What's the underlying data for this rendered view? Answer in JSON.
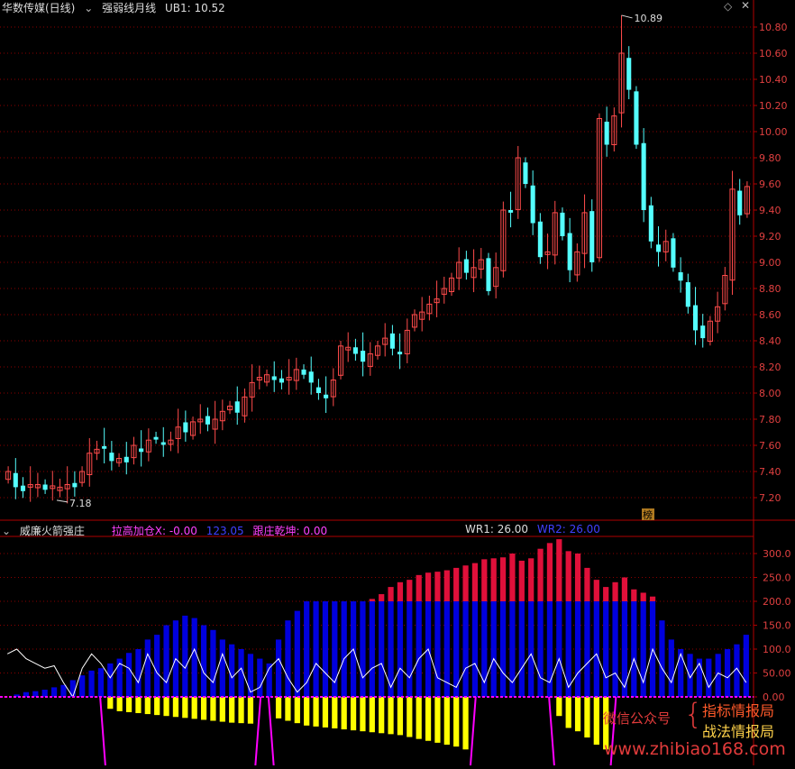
{
  "main": {
    "stock_title": "华数传媒(日线)",
    "indicator_name": "强弱线月线",
    "ub_label": "UB1: 10.52",
    "high_label": "10.89",
    "low_label": "7.18",
    "badge": "榜",
    "controls": {
      "settings_icon": "diamond-icon",
      "close_icon": "close-icon"
    },
    "ytick_labels": [
      "10.80",
      "10.60",
      "10.40",
      "10.20",
      "10.00",
      "9.80",
      "9.60",
      "9.40",
      "9.20",
      "9.00",
      "8.80",
      "8.60",
      "8.40",
      "8.20",
      "8.00",
      "7.80",
      "7.60",
      "7.40",
      "7.20"
    ]
  },
  "sub": {
    "title": "威廉火箭强庄",
    "val1": "拉高加仓X: -0.00",
    "val2": "123.05",
    "val3": "跟庄乾坤: 0.00",
    "wr1": "WR1: 26.00",
    "wr2": "WR2: 26.00",
    "ytick_labels": [
      "300.0",
      "250.0",
      "200.0",
      "150.0",
      "100.0",
      "50.00",
      "0.00"
    ]
  },
  "colors": {
    "up": "#ff4b4b",
    "down": "#54ffff",
    "grid": "#8b0000",
    "blue_bar": "#0000dd",
    "red_bar": "#e0103a",
    "yellow_bar": "#ffff00",
    "magenta": "#ff00ff",
    "white_line": "#ffffff"
  },
  "watermark": {
    "left": "微信公众号",
    "brace": "{",
    "right1": "指标情报局",
    "right2": "战法情报局",
    "url": "www.zhibiao168.com"
  },
  "chart_data": [
    {
      "type": "candlestick",
      "title": "华数传媒(日线)",
      "ylim": [
        7.1,
        10.9
      ],
      "high": 10.89,
      "low": 7.18,
      "closes": [
        7.4,
        7.28,
        7.25,
        7.3,
        7.3,
        7.26,
        7.29,
        7.28,
        7.3,
        7.28,
        7.4,
        7.54,
        7.57,
        7.58,
        7.48,
        7.5,
        7.47,
        7.6,
        7.55,
        7.64,
        7.66,
        7.62,
        7.64,
        7.74,
        7.7,
        7.78,
        7.8,
        7.76,
        7.8,
        7.86,
        7.9,
        7.85,
        7.97,
        8.08,
        8.12,
        8.14,
        8.1,
        8.08,
        8.12,
        8.18,
        8.14,
        8.08,
        8.0,
        7.96,
        8.1,
        8.36,
        8.35,
        8.3,
        8.24,
        8.3,
        8.36,
        8.42,
        8.34,
        8.3,
        8.48,
        8.6,
        8.62,
        8.68,
        8.72,
        8.8,
        8.88,
        9.0,
        8.92,
        8.96,
        9.02,
        8.78,
        8.96,
        9.4,
        9.38,
        9.8,
        9.6,
        9.3,
        9.04,
        9.08,
        9.38,
        9.2,
        8.94,
        9.08,
        9.38,
        9.0,
        10.1,
        9.9,
        10.12,
        10.6,
        10.32,
        9.9,
        9.4,
        9.16,
        9.08,
        9.16,
        8.96,
        8.86,
        8.66,
        8.48,
        8.42,
        8.55,
        8.66,
        8.9,
        9.56,
        9.36,
        9.58
      ]
    },
    {
      "type": "bar",
      "title": "威廉火箭强庄",
      "ylim": [
        -110,
        330
      ],
      "blue": [
        0,
        5,
        10,
        12,
        15,
        20,
        25,
        35,
        45,
        55,
        60,
        70,
        80,
        92,
        100,
        120,
        130,
        150,
        160,
        170,
        165,
        150,
        140,
        120,
        110,
        100,
        90,
        80,
        70,
        120,
        160,
        180,
        200,
        200,
        200,
        200,
        200,
        200,
        200,
        200,
        200,
        200,
        200,
        200,
        200,
        200,
        200,
        200,
        200,
        200,
        200,
        200,
        200,
        200,
        200,
        200,
        200,
        200,
        200,
        200,
        200,
        200,
        200,
        200,
        200,
        200,
        200,
        200,
        200,
        200,
        160,
        120,
        100,
        90,
        80,
        80,
        90,
        100,
        110,
        130
      ],
      "red": [
        0,
        0,
        0,
        0,
        0,
        0,
        0,
        0,
        0,
        0,
        0,
        0,
        0,
        0,
        0,
        0,
        0,
        0,
        0,
        0,
        0,
        0,
        0,
        0,
        0,
        0,
        0,
        0,
        0,
        0,
        0,
        0,
        0,
        0,
        0,
        0,
        0,
        0,
        0,
        205,
        215,
        230,
        240,
        245,
        255,
        260,
        262,
        265,
        270,
        275,
        280,
        288,
        290,
        292,
        300,
        285,
        290,
        310,
        322,
        330,
        305,
        300,
        270,
        245,
        230,
        240,
        250,
        225,
        218,
        210,
        0,
        0,
        0,
        0,
        0,
        0,
        0,
        0,
        0,
        0
      ],
      "yellow": [
        0,
        0,
        0,
        0,
        0,
        0,
        0,
        0,
        0,
        0,
        0,
        -25,
        -30,
        -32,
        -34,
        -36,
        -38,
        -40,
        -42,
        -44,
        -46,
        -48,
        -50,
        -52,
        -54,
        -55,
        -56,
        0,
        0,
        -45,
        -50,
        -55,
        -60,
        -62,
        -64,
        -66,
        -68,
        -70,
        -72,
        -74,
        -76,
        -78,
        -80,
        -84,
        -88,
        -92,
        -96,
        -100,
        -104,
        -110,
        0,
        0,
        0,
        0,
        0,
        0,
        0,
        0,
        0,
        -40,
        -65,
        -72,
        -85,
        -100,
        -110,
        0,
        0,
        0,
        0,
        0,
        0,
        0,
        0,
        0,
        0,
        0,
        0,
        0,
        0,
        0
      ],
      "white_line": [
        90,
        100,
        80,
        70,
        60,
        65,
        30,
        0,
        60,
        90,
        70,
        40,
        70,
        60,
        30,
        90,
        50,
        30,
        80,
        60,
        100,
        50,
        30,
        90,
        40,
        60,
        10,
        20,
        60,
        80,
        40,
        10,
        30,
        70,
        50,
        30,
        80,
        100,
        40,
        60,
        70,
        20,
        60,
        40,
        80,
        100,
        40,
        30,
        20,
        60,
        70,
        30,
        80,
        50,
        30,
        60,
        90,
        40,
        30,
        80,
        20,
        50,
        70,
        90,
        40,
        50,
        20,
        80,
        30,
        100,
        60,
        30,
        90,
        40,
        70,
        20,
        50,
        40,
        60,
        30
      ],
      "wr1": 26.0,
      "wr2": 26.0
    }
  ]
}
